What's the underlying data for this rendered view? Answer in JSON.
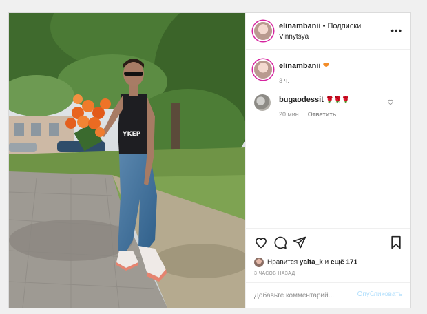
{
  "post": {
    "username": "elinambanii",
    "separator": "•",
    "follow_label": "Подписки",
    "location": "Vinnytsya",
    "more_label": "•••"
  },
  "caption": {
    "username": "elinambanii",
    "emoji": "❤",
    "time": "3 ч."
  },
  "comments": [
    {
      "username": "bugaodessit",
      "text": "🌹🌹🌹",
      "time": "20 мин.",
      "reply_label": "Ответить"
    }
  ],
  "likes": {
    "prefix": "Нравится",
    "user": "yalta_k",
    "middle": "и",
    "count_text": "ещё 171"
  },
  "timestamp": "3 ЧАСОВ НАЗАД",
  "comment_box": {
    "placeholder": "Добавьте комментарий...",
    "publish_label": "Опубликовать"
  },
  "icons": {
    "like": "heart-outline-icon",
    "comment": "speech-bubble-icon",
    "share": "paper-plane-icon",
    "save": "bookmark-icon",
    "comment_like": "small-heart-icon"
  },
  "colors": {
    "story_ring": "#d6249f",
    "publish_disabled": "#b2dffc",
    "muted_text": "#8e8e8e",
    "caption_heart": "#f28c28"
  }
}
